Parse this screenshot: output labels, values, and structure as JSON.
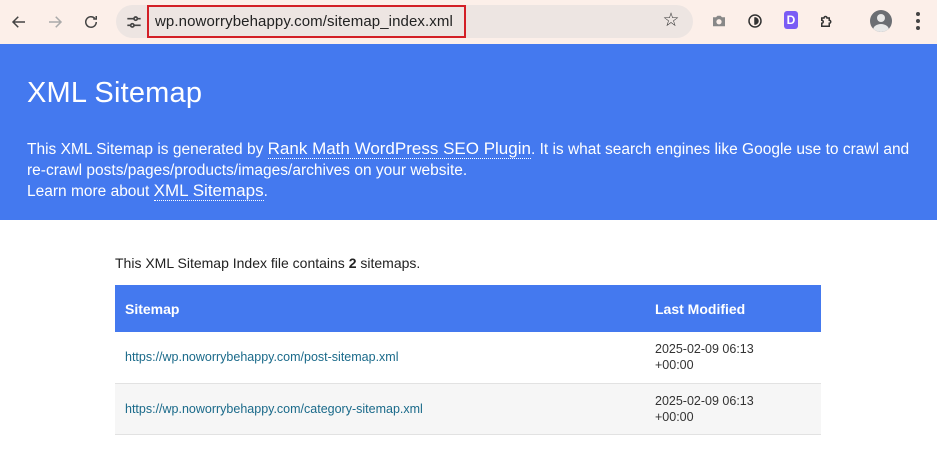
{
  "browser": {
    "url": "wp.noworrybehappy.com/sitemap_index.xml",
    "icons": {
      "back": "back-arrow-icon",
      "forward": "forward-arrow-icon",
      "reload": "reload-icon",
      "site_info": "site-info-icon",
      "bookmark": "star-icon",
      "screenshot": "camera-icon",
      "ext_a": "extension-icon",
      "ext_d_letter": "D",
      "extensions": "puzzle-icon",
      "profile": "avatar-icon",
      "menu": "kebab-menu-icon"
    }
  },
  "header": {
    "title": "XML Sitemap",
    "desc_before": "This XML Sitemap is generated by ",
    "desc_link": "Rank Math WordPress SEO Plugin",
    "desc_after": ". It is what search engines like Google use to crawl and re-crawl posts/pages/products/images/archives on your website.",
    "learn_before": "Learn more about ",
    "learn_link": "XML Sitemaps",
    "learn_after": "."
  },
  "content": {
    "intro_before": "This XML Sitemap Index file contains ",
    "intro_count": "2",
    "intro_after": " sitemaps.",
    "columns": [
      "Sitemap",
      "Last Modified"
    ],
    "rows": [
      {
        "url": "https://wp.noworrybehappy.com/post-sitemap.xml",
        "date_line1": "2025-02-09 06:13",
        "date_line2": "+00:00"
      },
      {
        "url": "https://wp.noworrybehappy.com/category-sitemap.xml",
        "date_line1": "2025-02-09 06:13",
        "date_line2": "+00:00"
      }
    ]
  },
  "colors": {
    "banner": "#4479ef",
    "toolbar": "#fcefe9",
    "url_highlight": "#d31f26",
    "link": "#1a6a8a"
  }
}
